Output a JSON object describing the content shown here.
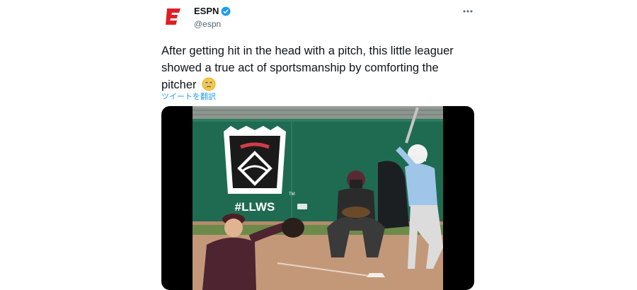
{
  "tweet": {
    "author": {
      "display_name": "ESPN",
      "handle": "@espn",
      "verified": true,
      "avatar_letter": "E",
      "brand_color": "#e01e26"
    },
    "more_icon": "more-options-icon",
    "text": "After getting hit in the head with a pitch, this little leaguer showed a true act of sportsmanship by comforting the pitcher",
    "emoji": "face-holding-back-tears",
    "translate_label": "ツイートを翻訳",
    "media": {
      "type": "video",
      "wall_text": "#LLWS",
      "tm": "TM"
    }
  },
  "colors": {
    "link": "#1d9bf0",
    "secondary_text": "#536471",
    "primary_text": "#0f1419",
    "outfield_wall": "#1f6b52"
  }
}
